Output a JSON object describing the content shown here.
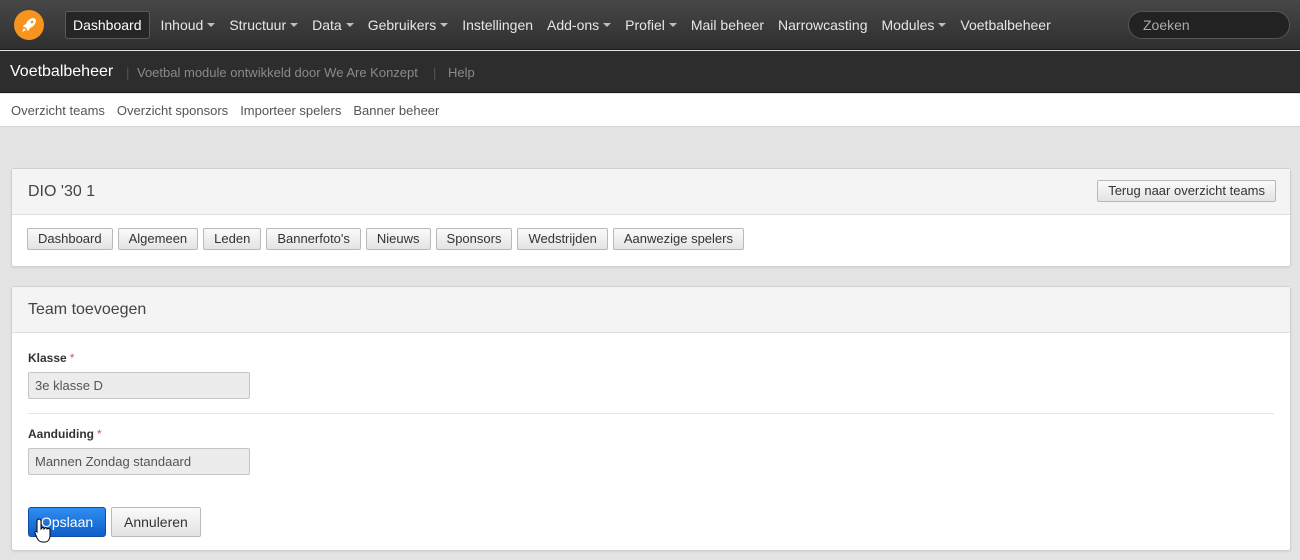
{
  "topnav": {
    "items": [
      {
        "label": "Dashboard",
        "dropdown": false,
        "active": true
      },
      {
        "label": "Inhoud",
        "dropdown": true
      },
      {
        "label": "Structuur",
        "dropdown": true
      },
      {
        "label": "Data",
        "dropdown": true
      },
      {
        "label": "Gebruikers",
        "dropdown": true
      },
      {
        "label": "Instellingen",
        "dropdown": false
      },
      {
        "label": "Add-ons",
        "dropdown": true
      },
      {
        "label": "Profiel",
        "dropdown": true
      },
      {
        "label": "Mail beheer",
        "dropdown": false
      },
      {
        "label": "Narrowcasting",
        "dropdown": false
      },
      {
        "label": "Modules",
        "dropdown": true
      },
      {
        "label": "Voetbalbeheer",
        "dropdown": false
      }
    ],
    "search_placeholder": "Zoeken",
    "logo_icon": "rocket-icon",
    "accent_color": "#f7941d"
  },
  "subbar": {
    "title": "Voetbalbeheer",
    "description": "Voetbal module ontwikkeld door We Are Konzept",
    "help": "Help"
  },
  "subnav": [
    "Overzicht teams",
    "Overzicht sponsors",
    "Importeer spelers",
    "Banner beheer"
  ],
  "team_panel": {
    "title": "DIO '30 1",
    "back_button": "Terug naar overzicht teams",
    "tabs": [
      "Dashboard",
      "Algemeen",
      "Leden",
      "Bannerfoto's",
      "Nieuws",
      "Sponsors",
      "Wedstrijden",
      "Aanwezige spelers"
    ]
  },
  "form": {
    "title": "Team toevoegen",
    "fields": [
      {
        "label": "Klasse",
        "required_mark": "*",
        "value": "3e klasse D"
      },
      {
        "label": "Aanduiding",
        "required_mark": "*",
        "value": "Mannen Zondag standaard"
      }
    ],
    "save_label": "Opslaan",
    "cancel_label": "Annuleren"
  }
}
